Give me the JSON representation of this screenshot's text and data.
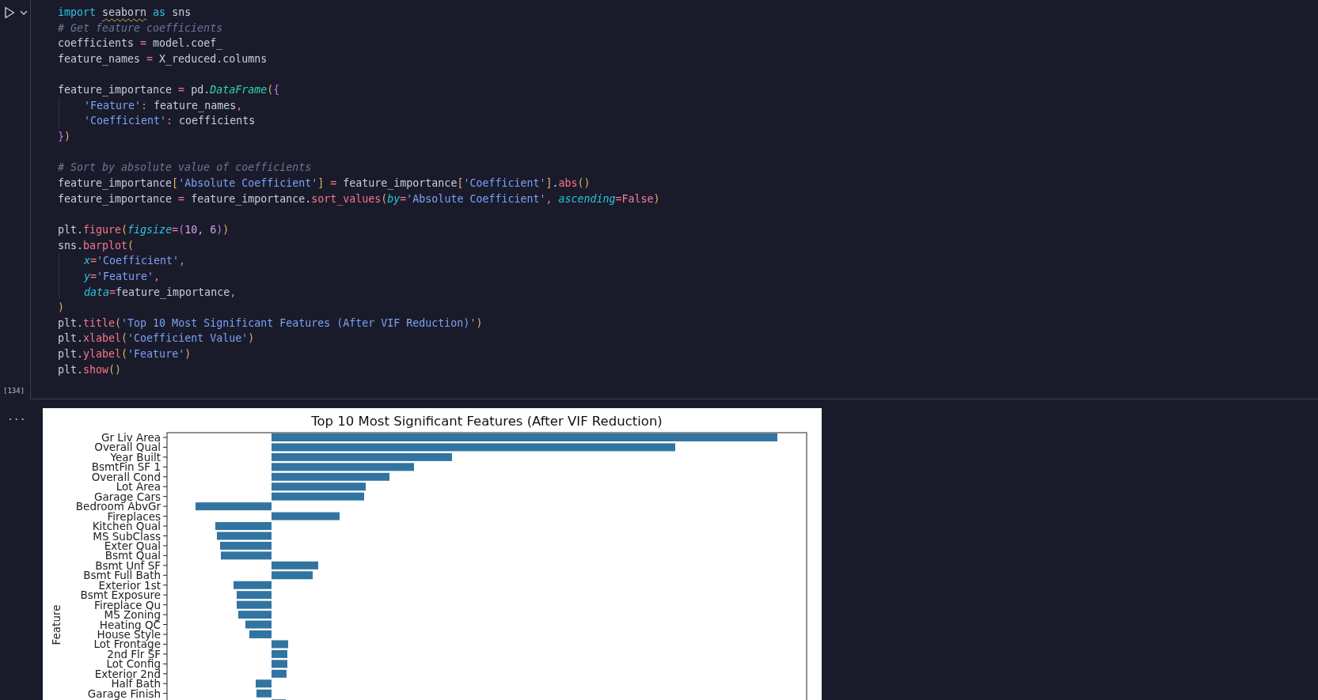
{
  "cell": {
    "execution_count": "[134]",
    "lines": [
      {
        "kind": "code",
        "tokens": [
          {
            "text": "import ",
            "kind": "keyword"
          },
          {
            "text": "seaborn",
            "kind": "plain",
            "warning": true
          },
          {
            "text": " as",
            "kind": "keyword"
          },
          {
            "text": " sns",
            "kind": "plain"
          }
        ]
      },
      {
        "kind": "code",
        "tokens": [
          {
            "text": "# Get feature coefficients",
            "kind": "comment"
          }
        ]
      },
      {
        "kind": "code",
        "tokens": [
          {
            "text": "coefficients ",
            "kind": "plain"
          },
          {
            "text": "=",
            "kind": "operator"
          },
          {
            "text": " model.coef_",
            "kind": "plain"
          }
        ]
      },
      {
        "kind": "code",
        "tokens": [
          {
            "text": "feature_names ",
            "kind": "plain"
          },
          {
            "text": "=",
            "kind": "operator"
          },
          {
            "text": " X_reduced.columns",
            "kind": "plain"
          }
        ]
      },
      {
        "kind": "blank"
      },
      {
        "kind": "code",
        "tokens": [
          {
            "text": "feature_importance ",
            "kind": "plain"
          },
          {
            "text": "=",
            "kind": "operator"
          },
          {
            "text": " pd.",
            "kind": "plain"
          },
          {
            "text": "DataFrame",
            "kind": "class"
          },
          {
            "text": "(",
            "kind": "bracket"
          },
          {
            "text": "{",
            "kind": "bracket2"
          }
        ]
      },
      {
        "kind": "code",
        "indent": true,
        "tokens": [
          {
            "text": "'Feature'",
            "kind": "string"
          },
          {
            "text": ":",
            "kind": "operator"
          },
          {
            "text": " feature_names",
            "kind": "plain"
          },
          {
            "text": ",",
            "kind": "punct"
          }
        ]
      },
      {
        "kind": "code",
        "indent": true,
        "tokens": [
          {
            "text": "'Coefficient'",
            "kind": "string"
          },
          {
            "text": ":",
            "kind": "operator"
          },
          {
            "text": " coefficients",
            "kind": "plain"
          }
        ]
      },
      {
        "kind": "code",
        "tokens": [
          {
            "text": "}",
            "kind": "bracket2"
          },
          {
            "text": ")",
            "kind": "bracket"
          }
        ]
      },
      {
        "kind": "blank"
      },
      {
        "kind": "code",
        "tokens": [
          {
            "text": "# Sort by absolute value of coefficients",
            "kind": "comment"
          }
        ]
      },
      {
        "kind": "code",
        "tokens": [
          {
            "text": "feature_importance",
            "kind": "plain"
          },
          {
            "text": "[",
            "kind": "bracket"
          },
          {
            "text": "'Absolute Coefficient'",
            "kind": "string"
          },
          {
            "text": "]",
            "kind": "bracket"
          },
          {
            "text": " =",
            "kind": "operator"
          },
          {
            "text": " feature_importance",
            "kind": "plain"
          },
          {
            "text": "[",
            "kind": "bracket"
          },
          {
            "text": "'Coefficient'",
            "kind": "string"
          },
          {
            "text": "]",
            "kind": "bracket"
          },
          {
            "text": ".",
            "kind": "plain"
          },
          {
            "text": "abs",
            "kind": "function"
          },
          {
            "text": "()",
            "kind": "bracket"
          }
        ]
      },
      {
        "kind": "code",
        "tokens": [
          {
            "text": "feature_importance ",
            "kind": "plain"
          },
          {
            "text": "=",
            "kind": "operator"
          },
          {
            "text": " feature_importance.",
            "kind": "plain"
          },
          {
            "text": "sort_values",
            "kind": "function"
          },
          {
            "text": "(",
            "kind": "bracket"
          },
          {
            "text": "by",
            "kind": "param"
          },
          {
            "text": "=",
            "kind": "operator"
          },
          {
            "text": "'Absolute Coefficient'",
            "kind": "string"
          },
          {
            "text": ", ",
            "kind": "punct"
          },
          {
            "text": "ascending",
            "kind": "param"
          },
          {
            "text": "=",
            "kind": "operator"
          },
          {
            "text": "False",
            "kind": "constant"
          },
          {
            "text": ")",
            "kind": "bracket"
          }
        ]
      },
      {
        "kind": "blank"
      },
      {
        "kind": "code",
        "tokens": [
          {
            "text": "plt.",
            "kind": "plain"
          },
          {
            "text": "figure",
            "kind": "function"
          },
          {
            "text": "(",
            "kind": "bracket"
          },
          {
            "text": "figsize",
            "kind": "param"
          },
          {
            "text": "=",
            "kind": "operator"
          },
          {
            "text": "(",
            "kind": "bracket2"
          },
          {
            "text": "10, 6",
            "kind": "number"
          },
          {
            "text": ")",
            "kind": "bracket2"
          },
          {
            "text": ")",
            "kind": "bracket"
          }
        ]
      },
      {
        "kind": "code",
        "tokens": [
          {
            "text": "sns.",
            "kind": "plain"
          },
          {
            "text": "barplot",
            "kind": "function"
          },
          {
            "text": "(",
            "kind": "bracket"
          }
        ]
      },
      {
        "kind": "code",
        "indent": true,
        "tokens": [
          {
            "text": "x",
            "kind": "param"
          },
          {
            "text": "=",
            "kind": "operator"
          },
          {
            "text": "'Coefficient'",
            "kind": "string"
          },
          {
            "text": ",",
            "kind": "punct"
          }
        ]
      },
      {
        "kind": "code",
        "indent": true,
        "tokens": [
          {
            "text": "y",
            "kind": "param"
          },
          {
            "text": "=",
            "kind": "operator"
          },
          {
            "text": "'Feature'",
            "kind": "string"
          },
          {
            "text": ",",
            "kind": "punct"
          }
        ]
      },
      {
        "kind": "code",
        "indent": true,
        "tokens": [
          {
            "text": "data",
            "kind": "param"
          },
          {
            "text": "=",
            "kind": "operator"
          },
          {
            "text": "feature_importance",
            "kind": "plain"
          },
          {
            "text": ",",
            "kind": "punct"
          }
        ]
      },
      {
        "kind": "code",
        "tokens": [
          {
            "text": ")",
            "kind": "bracket"
          }
        ]
      },
      {
        "kind": "code",
        "tokens": [
          {
            "text": "plt.",
            "kind": "plain"
          },
          {
            "text": "title",
            "kind": "function"
          },
          {
            "text": "(",
            "kind": "bracket"
          },
          {
            "text": "'Top 10 Most Significant Features (After VIF Reduction)'",
            "kind": "string"
          },
          {
            "text": ")",
            "kind": "bracket"
          }
        ]
      },
      {
        "kind": "code",
        "tokens": [
          {
            "text": "plt.",
            "kind": "plain"
          },
          {
            "text": "xlabel",
            "kind": "function"
          },
          {
            "text": "(",
            "kind": "bracket"
          },
          {
            "text": "'Coefficient Value'",
            "kind": "string"
          },
          {
            "text": ")",
            "kind": "bracket"
          }
        ]
      },
      {
        "kind": "code",
        "tokens": [
          {
            "text": "plt.",
            "kind": "plain"
          },
          {
            "text": "ylabel",
            "kind": "function"
          },
          {
            "text": "(",
            "kind": "bracket"
          },
          {
            "text": "'Feature'",
            "kind": "string"
          },
          {
            "text": ")",
            "kind": "bracket"
          }
        ]
      },
      {
        "kind": "code",
        "tokens": [
          {
            "text": "plt.",
            "kind": "plain"
          },
          {
            "text": "show",
            "kind": "function"
          },
          {
            "text": "()",
            "kind": "bracket"
          }
        ]
      }
    ]
  },
  "output": {
    "more": "...",
    "chart": {
      "title": "Top 10 Most Significant Features (After VIF Reduction)",
      "ylabel": "Feature",
      "features": [
        "Gr Liv Area",
        "Overall Qual",
        "Year Built",
        "BsmtFin SF 1",
        "Overall Cond",
        "Lot Area",
        "Garage Cars",
        "Bedroom AbvGr",
        "Fireplaces",
        "Kitchen Qual",
        "MS SubClass",
        "Exter Qual",
        "Bsmt Qual",
        "Bsmt Unf SF",
        "Bsmt Full Bath",
        "Exterior 1st",
        "Bsmt Exposure",
        "Fireplace Qu",
        "MS Zoning",
        "Heating QC",
        "House Style",
        "Lot Frontage",
        "2nd Flr SF",
        "Lot Config",
        "Exterior 2nd",
        "Half Bath",
        "Garage Finish"
      ]
    }
  }
}
